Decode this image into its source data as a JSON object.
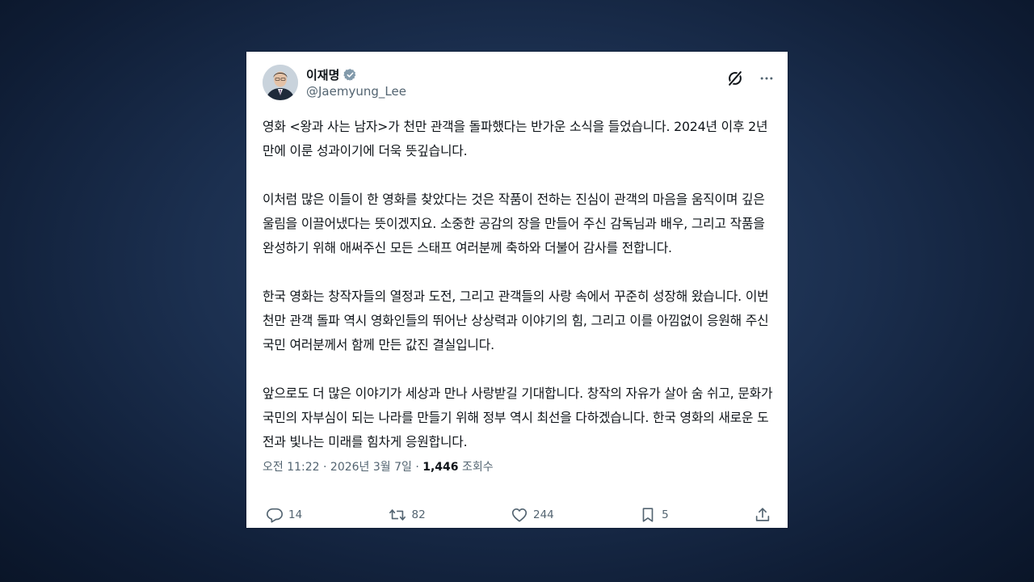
{
  "author": {
    "display_name": "이재명",
    "handle": "@Jaemyung_Lee"
  },
  "tweet": {
    "paragraphs": [
      "영화 <왕과 사는 남자>가 천만 관객을 돌파했다는 반가운 소식을 들었습니다. 2024년 이후 2년 만에 이룬 성과이기에 더욱 뜻깊습니다.",
      "이처럼 많은 이들이 한 영화를 찾았다는 것은 작품이 전하는 진심이 관객의 마음을 움직이며 깊은 울림을 이끌어냈다는 뜻이겠지요. 소중한 공감의 장을 만들어 주신 감독님과 배우, 그리고 작품을 완성하기 위해 애써주신 모든 스태프 여러분께 축하와 더불어 감사를 전합니다.",
      "한국 영화는 창작자들의 열정과 도전, 그리고 관객들의 사랑 속에서 꾸준히 성장해 왔습니다. 이번 천만 관객 돌파 역시 영화인들의 뛰어난 상상력과 이야기의 힘, 그리고 이를 아낌없이 응원해 주신 국민 여러분께서 함께 만든 값진 결실입니다.",
      "앞으로도 더 많은 이야기가 세상과 만나 사랑받길 기대합니다. 창작의 자유가 살아 숨 쉬고, 문화가 국민의 자부심이 되는 나라를 만들기 위해 정부 역시 최선을 다하겠습니다. 한국 영화의 새로운 도전과 빛나는 미래를 힘차게 응원합니다."
    ]
  },
  "meta": {
    "timestamp": "오전 11:22 · 2026년 3월 7일 · ",
    "views_count": "1,446",
    "views_label": " 조회수"
  },
  "actions": {
    "replies": "14",
    "reposts": "82",
    "likes": "244",
    "bookmarks": "5"
  },
  "icons": {
    "verified": "verified-badge-icon",
    "grok": "grok-icon",
    "more": "more-icon",
    "reply": "reply-icon",
    "repost": "repost-icon",
    "like": "like-icon",
    "bookmark": "bookmark-icon",
    "share": "share-icon"
  },
  "colors": {
    "verified": "#829aab",
    "text": "#0f1419",
    "secondary": "#536471"
  }
}
